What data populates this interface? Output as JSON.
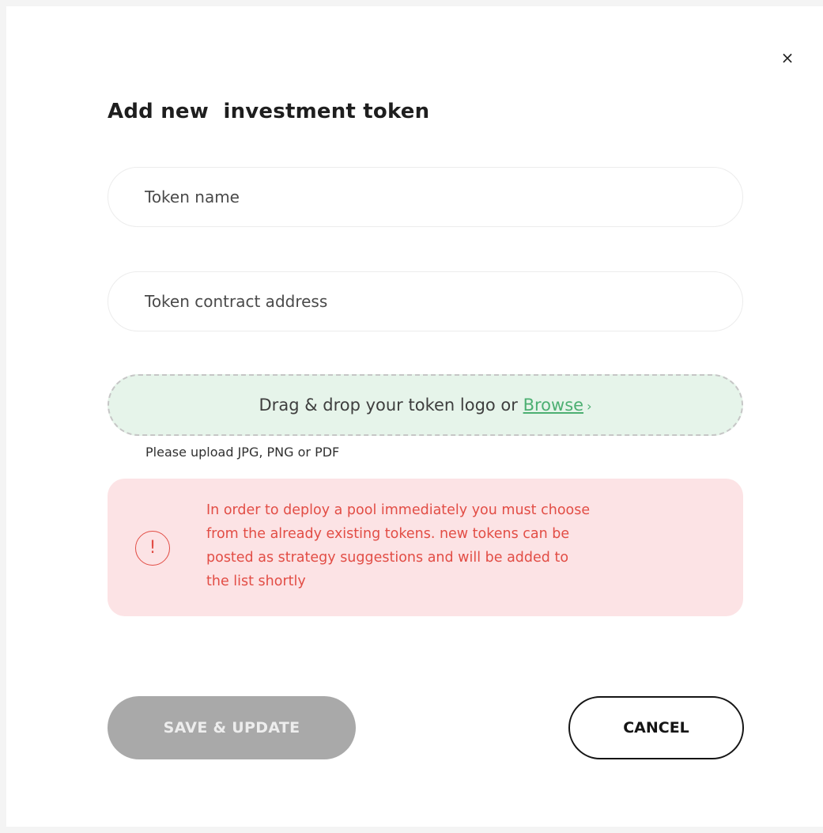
{
  "dialog": {
    "title": "Add new  investment token",
    "close_label": "×"
  },
  "form": {
    "token_name": {
      "value": "",
      "placeholder": "Token name"
    },
    "token_address": {
      "value": "",
      "placeholder": "Token contract address"
    }
  },
  "upload": {
    "prompt": "Drag & drop your token logo or ",
    "browse_label": "Browse",
    "browse_chevron": "›",
    "hint": "Please upload JPG, PNG or PDF"
  },
  "warning": {
    "icon_symbol": "!",
    "text": " In order to deploy a pool immediately you must choose\nfrom the already existing tokens. new tokens can be\nposted as strategy  suggestions and will be added to\nthe list shortly"
  },
  "actions": {
    "save_label": "SAVE & UPDATE",
    "cancel_label": "CANCEL"
  },
  "colors": {
    "accent_green": "#4caf72",
    "dropzone_bg": "#e6f4ea",
    "warning_text": "#e24d45",
    "warning_bg": "#fce3e5",
    "save_disabled_bg": "#a9a9a9"
  },
  "icons": {
    "close": "close-icon",
    "warning": "alert-circle-icon",
    "browse": "chevron-right-icon"
  }
}
